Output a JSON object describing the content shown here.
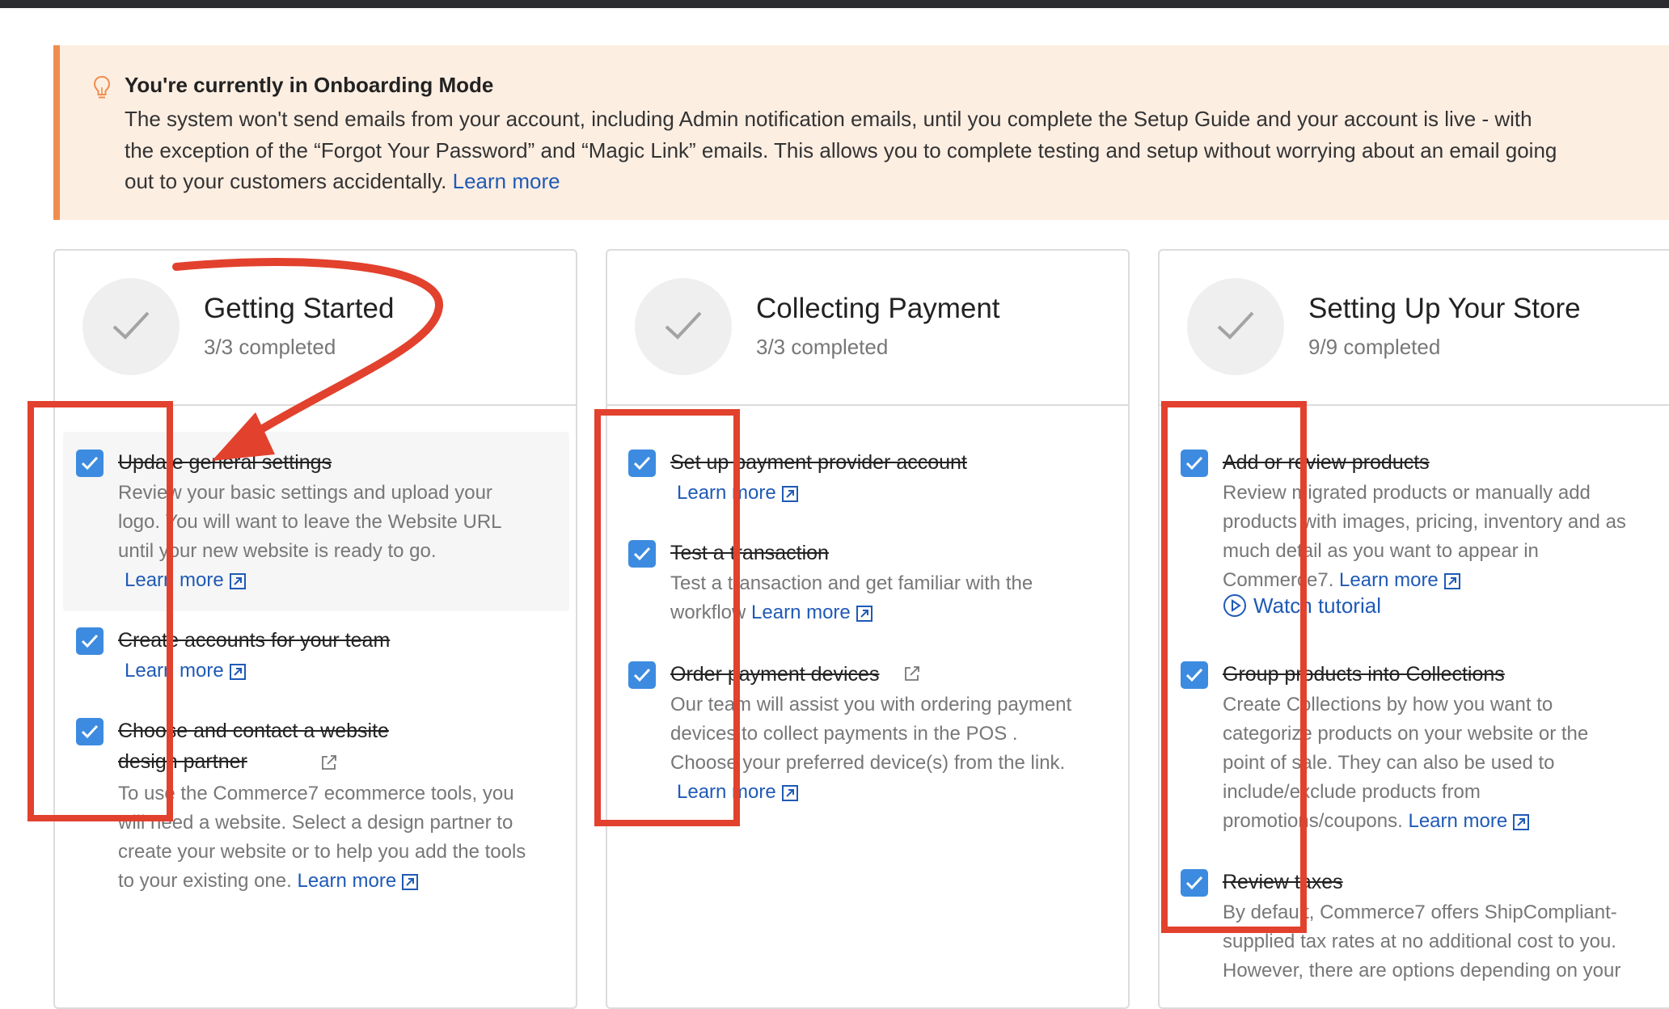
{
  "banner": {
    "icon": "lightbulb-icon",
    "title": "You're currently in Onboarding Mode",
    "lines": [
      "The system won't send emails from your account, including Admin notification emails, until you complete the Setup Guide and your account is live - with",
      "the exception of the “Forgot Your Password” and “Magic Link” emails. This allows you to complete testing and setup without worrying about an email going",
      "out to your customers accidentally."
    ],
    "link": "Learn more"
  },
  "cards": [
    {
      "title": "Getting Started",
      "progress": "3/3 completed",
      "tasks": [
        {
          "title": "Update general settings",
          "desc": [
            "Review your basic settings and upload your",
            "logo. You will want to leave the Website URL",
            "until your new website is ready to go."
          ],
          "link": "Learn more"
        },
        {
          "title": "Create accounts for your team",
          "link": "Learn more"
        },
        {
          "title": [
            "Choose and contact a website",
            "design partner"
          ],
          "desc": [
            "To use the Commerce7 ecommerce tools, you",
            "will need a website. Select a design partner to",
            "create your website or to help you add the tools",
            "to your existing one."
          ],
          "link": "Learn more"
        }
      ]
    },
    {
      "title": "Collecting Payment",
      "progress": "3/3 completed",
      "tasks": [
        {
          "title": "Set up payment provider account",
          "link": "Learn more"
        },
        {
          "title": "Test a transaction",
          "desc": [
            "Test a transaction and get familiar with the",
            "workflow"
          ],
          "link": "Learn more"
        },
        {
          "title": "Order payment devices",
          "desc": [
            "Our team will assist you with ordering payment",
            "devices to collect payments in the POS .",
            "Choose your preferred device(s) from the link."
          ],
          "link": "Learn more"
        }
      ]
    },
    {
      "title": "Setting Up Your Store",
      "progress": "9/9 completed",
      "tasks": [
        {
          "title": "Add or review products",
          "desc": [
            "Review migrated products or manually add",
            "products with images, pricing, inventory and as",
            "much detail as you want to appear in",
            "Commerce7."
          ],
          "link": "Learn more",
          "watch": "Watch tutorial"
        },
        {
          "title": "Group products into Collections",
          "desc": [
            "Create Collections by how you want to",
            "categorize products on your website or the",
            "point of sale. They can also be used to",
            "include/exclude products from",
            "promotions/coupons."
          ],
          "link": "Learn more"
        },
        {
          "title": "Review taxes",
          "desc": [
            "By default, Commerce7 offers ShipCompliant-",
            "supplied tax rates at no additional cost to you.",
            "However, there are options depending on your"
          ]
        }
      ]
    }
  ],
  "colors": {
    "accent": "#3d8be0",
    "link": "#1f5ab6",
    "annotation": "#e2412d",
    "banner_bg": "#fdeee2",
    "banner_border": "#ef8d4e"
  }
}
